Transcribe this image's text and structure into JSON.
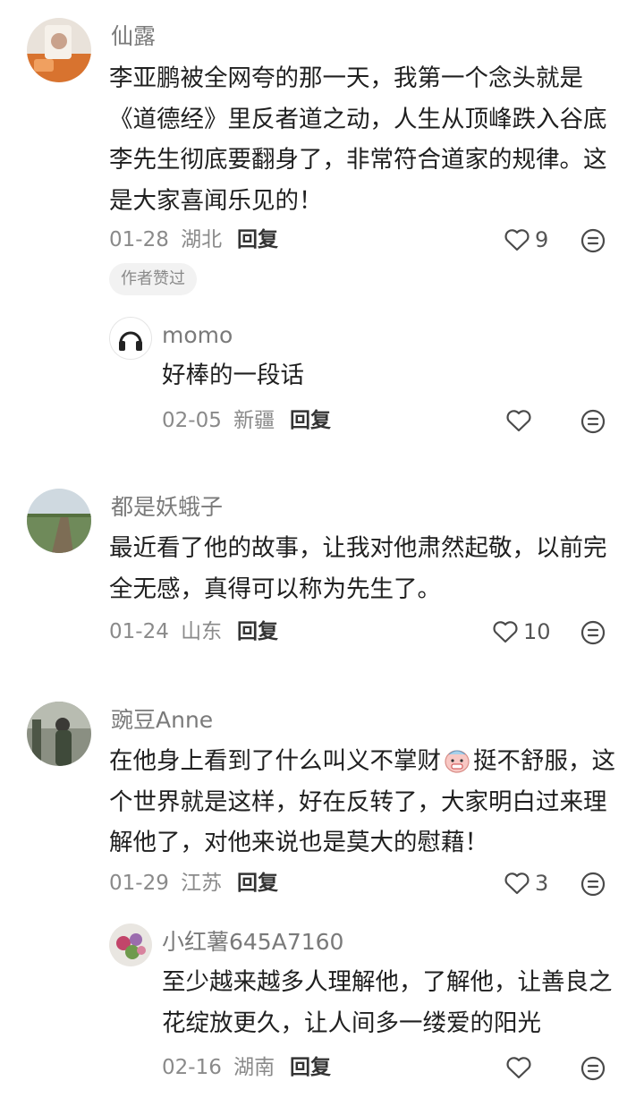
{
  "comments": [
    {
      "user": "仙露",
      "text": "李亚鹏被全网夸的那一天，我第一个念头就是《道德经》里反者道之动，人生从顶峰跌入谷底李先生彻底要翻身了，非常符合道家的规律。这是大家喜闻乐见的！",
      "date": "01-28",
      "location": "湖北",
      "reply_label": "回复",
      "likes": "9",
      "badge": "作者赞过",
      "replies": [
        {
          "user": "momo",
          "text": "好棒的一段话",
          "date": "02-05",
          "location": "新疆",
          "reply_label": "回复"
        }
      ]
    },
    {
      "user": "都是妖蛾子",
      "text": "最近看了他的故事，让我对他肃然起敬，以前完全无感，真得可以称为先生了。",
      "date": "01-24",
      "location": "山东",
      "reply_label": "回复",
      "likes": "10"
    },
    {
      "user": "豌豆Anne",
      "text_before_emoji": "在他身上看到了什么叫义不掌财",
      "text_after_emoji": "挺不舒服，这个世界就是这样，好在反转了，大家明白过来理解他了，对他来说也是莫大的慰藉！",
      "date": "01-29",
      "location": "江苏",
      "reply_label": "回复",
      "likes": "3",
      "replies": [
        {
          "user": "小红薯645A7160",
          "text": "至少越来越多人理解他，了解他，让善良之花绽放更久，让人间多一缕爱的阳光",
          "date": "02-16",
          "location": "湖南",
          "reply_label": "回复"
        }
      ]
    }
  ]
}
